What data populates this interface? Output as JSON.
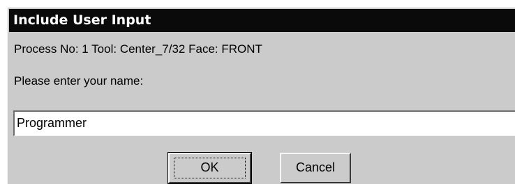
{
  "dialog": {
    "title": "Include User Input",
    "info_line": "Process No: 1 Tool: Center_7/32 Face: FRONT",
    "prompt": "Please enter your name:",
    "name_input": {
      "value": "Programmer",
      "placeholder": ""
    },
    "buttons": {
      "ok_label": "OK",
      "cancel_label": "Cancel"
    }
  },
  "colors": {
    "titlebar_bg": "#0a0a0a",
    "dialog_bg": "#cbcbcb",
    "input_bg": "#ffffff"
  }
}
